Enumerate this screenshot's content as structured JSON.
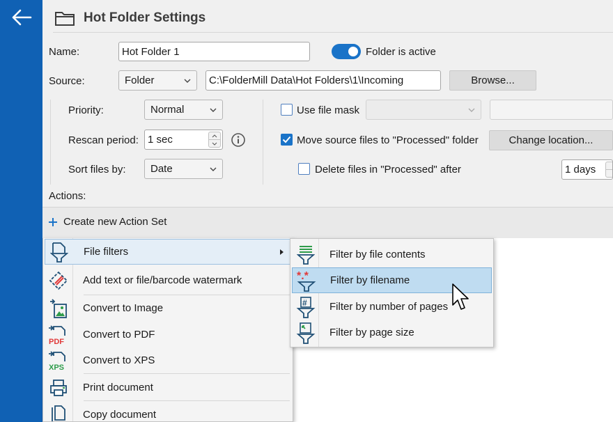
{
  "header": {
    "title": "Hot Folder Settings"
  },
  "form": {
    "name_label": "Name:",
    "name_value": "Hot Folder 1",
    "active_label": "Folder is active",
    "source_label": "Source:",
    "source_value": "Folder",
    "path_value": "C:\\FolderMill Data\\Hot Folders\\1\\Incoming",
    "browse_label": "Browse...",
    "priority_label": "Priority:",
    "priority_value": "Normal",
    "rescan_label": "Rescan period:",
    "rescan_value": "1 sec",
    "sort_label": "Sort files by:",
    "sort_value": "Date",
    "file_mask_label": "Use file mask",
    "move_label": "Move source files to \"Processed\" folder",
    "change_location_label": "Change location...",
    "delete_label": "Delete files in \"Processed\" after",
    "delete_value": "1 days",
    "actions_label": "Actions:"
  },
  "actions": {
    "create_label": "Create new Action Set"
  },
  "menu": {
    "items": [
      {
        "label": "File filters",
        "icon": "funnel-icon"
      },
      {
        "label": "Add text or file/barcode watermark",
        "icon": "watermark-icon"
      },
      {
        "label": "Convert to Image",
        "icon": "image-icon"
      },
      {
        "label": "Convert to PDF",
        "icon": "pdf-icon"
      },
      {
        "label": "Convert to XPS",
        "icon": "xps-icon"
      },
      {
        "label": "Print document",
        "icon": "printer-icon"
      },
      {
        "label": "Copy document",
        "icon": "copy-icon"
      }
    ]
  },
  "submenu": {
    "items": [
      {
        "label": "Filter by file contents",
        "icon": "filter-contents-icon"
      },
      {
        "label": "Filter by filename",
        "icon": "filter-filename-icon"
      },
      {
        "label": "Filter by number of pages",
        "icon": "filter-pages-icon"
      },
      {
        "label": "Filter by page size",
        "icon": "filter-size-icon"
      }
    ]
  },
  "icon_text": {
    "pdf": "PDF",
    "xps": "XPS",
    "wildcard": "*.*",
    "hash": "#"
  },
  "colors": {
    "sidebar": "#1061b4",
    "accent": "#1a73c8",
    "selection": "#bfdcf1",
    "panel": "#f0f0f0",
    "icon_dark": "#1f4f75",
    "icon_red": "#e03a3a",
    "icon_green": "#2e9c4a"
  }
}
